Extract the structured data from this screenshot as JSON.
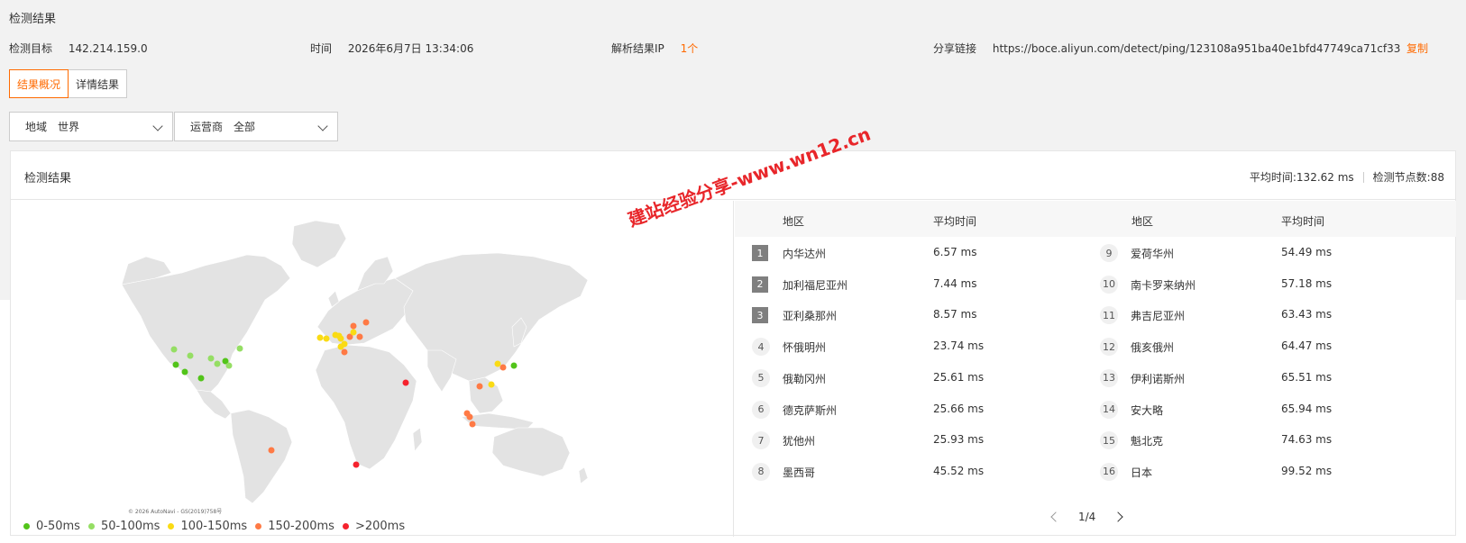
{
  "page": {
    "title": "检测结果"
  },
  "info": {
    "target_label": "检测目标",
    "target_value": "142.214.159.0",
    "time_label": "时间",
    "time_value": "2026年6月7日 13:34:06",
    "ip_label": "解析结果IP",
    "ip_value": "1个",
    "share_label": "分享链接",
    "share_value": "https://boce.aliyun.com/detect/ping/123108a951ba40e1bfd47749ca71cf33",
    "copy_label": "复制"
  },
  "tabs": [
    {
      "label": "结果概况",
      "active": true
    },
    {
      "label": "详情结果",
      "active": false
    }
  ],
  "filters": {
    "region_label": "地域",
    "region_value": "世界",
    "isp_label": "运营商",
    "isp_value": "全部"
  },
  "card": {
    "title": "检测结果",
    "avg_time": "平均时间:132.62 ms",
    "node_count": "检测节点数:88"
  },
  "map": {
    "credit": "© 2026 AutoNavi - GS(2019)758号",
    "legend": [
      {
        "label": "0-50ms",
        "color": "#52c41a"
      },
      {
        "label": "50-100ms",
        "color": "#95de64"
      },
      {
        "label": "100-150ms",
        "color": "#fadb14"
      },
      {
        "label": "150-200ms",
        "color": "#ff7a45"
      },
      {
        "label": ">200ms",
        "color": "#f5222d"
      }
    ]
  },
  "table": {
    "headers": {
      "region": "地区",
      "avg": "平均时间",
      "region2": "地区",
      "avg2": "平均时间"
    },
    "left": [
      {
        "rank": "1",
        "region": "内华达州",
        "avg": "6.57 ms"
      },
      {
        "rank": "2",
        "region": "加利福尼亚州",
        "avg": "7.44 ms"
      },
      {
        "rank": "3",
        "region": "亚利桑那州",
        "avg": "8.57 ms"
      },
      {
        "rank": "4",
        "region": "怀俄明州",
        "avg": "23.74 ms"
      },
      {
        "rank": "5",
        "region": "俄勒冈州",
        "avg": "25.61 ms"
      },
      {
        "rank": "6",
        "region": "德克萨斯州",
        "avg": "25.66 ms"
      },
      {
        "rank": "7",
        "region": "犹他州",
        "avg": "25.93 ms"
      },
      {
        "rank": "8",
        "region": "墨西哥",
        "avg": "45.52 ms"
      }
    ],
    "right": [
      {
        "rank": "9",
        "region": "爱荷华州",
        "avg": "54.49 ms"
      },
      {
        "rank": "10",
        "region": "南卡罗来纳州",
        "avg": "57.18 ms"
      },
      {
        "rank": "11",
        "region": "弗吉尼亚州",
        "avg": "63.43 ms"
      },
      {
        "rank": "12",
        "region": "俄亥俄州",
        "avg": "64.47 ms"
      },
      {
        "rank": "13",
        "region": "伊利诺斯州",
        "avg": "65.51 ms"
      },
      {
        "rank": "14",
        "region": "安大略",
        "avg": "65.94 ms"
      },
      {
        "rank": "15",
        "region": "魁北克",
        "avg": "74.63 ms"
      },
      {
        "rank": "16",
        "region": "日本",
        "avg": "99.52 ms"
      }
    ],
    "pager": "1/4"
  },
  "watermark": "建站经验分享-www.wn12.cn"
}
